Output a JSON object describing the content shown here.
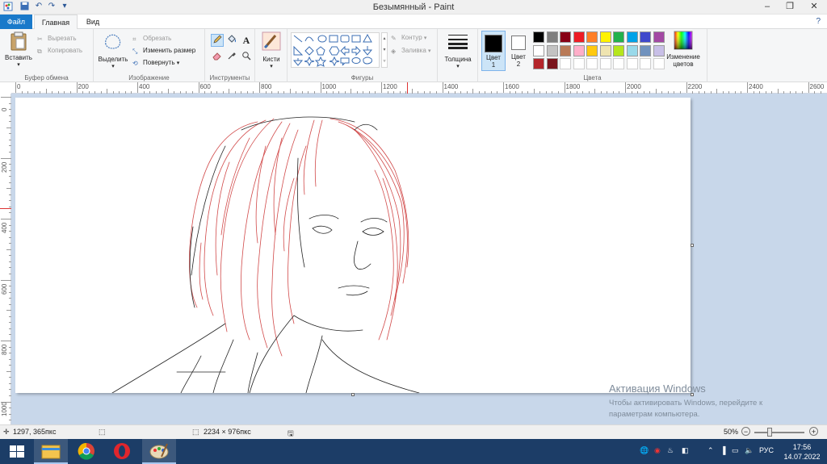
{
  "window": {
    "title": "Безымянный - Paint"
  },
  "tabs": {
    "file": "Файл",
    "home": "Главная",
    "view": "Вид"
  },
  "clipboard": {
    "paste": "Вставить",
    "cut": "Вырезать",
    "copy": "Копировать",
    "group_label": "Буфер обмена"
  },
  "image": {
    "select": "Выделить",
    "crop": "Обрезать",
    "resize": "Изменить размер",
    "rotate": "Повернуть",
    "group_label": "Изображение"
  },
  "tools": {
    "group_label": "Инструменты",
    "text_glyph": "A"
  },
  "brushes": {
    "label": "Кисти"
  },
  "shapes": {
    "outline": "Контур",
    "fill": "Заливка",
    "group_label": "Фигуры"
  },
  "size": {
    "label": "Толщина"
  },
  "colors": {
    "color1_label": "Цвет",
    "color1_num": "1",
    "color2_label": "Цвет",
    "color2_num": "2",
    "group_label": "Цвета",
    "edit_label_line1": "Изменение",
    "edit_label_line2": "цветов",
    "color1_value": "#000000",
    "color2_value": "#ffffff",
    "palette_row1": [
      "#000000",
      "#7f7f7f",
      "#880015",
      "#ed1c24",
      "#ff7f27",
      "#fff200",
      "#22b14c",
      "#00a2e8",
      "#3f48cc",
      "#a349a4"
    ],
    "palette_row2": [
      "#ffffff",
      "#c3c3c3",
      "#b97a57",
      "#ffaec9",
      "#ffc90e",
      "#efe4b0",
      "#b5e61d",
      "#99d9ea",
      "#7092be",
      "#c8bfe7"
    ],
    "palette_row3": [
      "#b4252b",
      "#7a141c"
    ]
  },
  "ruler": {
    "h_labels": [
      "0",
      "200",
      "400",
      "600",
      "800",
      "1000",
      "1200",
      "1400",
      "1600",
      "1800",
      "2000",
      "2200",
      "2400",
      "2600"
    ],
    "v_labels": [
      "0",
      "200",
      "400",
      "600",
      "800",
      "1000"
    ]
  },
  "statusbar": {
    "cursor_pos": "1297, 365пкс",
    "image_size": "2234 × 976пкс",
    "zoom": "50%",
    "zoom_minus": "−",
    "zoom_plus": "+"
  },
  "activation": {
    "title": "Активация Windows",
    "line1": "Чтобы активировать Windows, перейдите к",
    "line2": "параметрам компьютера."
  },
  "taskbar": {
    "language": "РУС",
    "time": "17:56",
    "date": "14.07.2022"
  }
}
